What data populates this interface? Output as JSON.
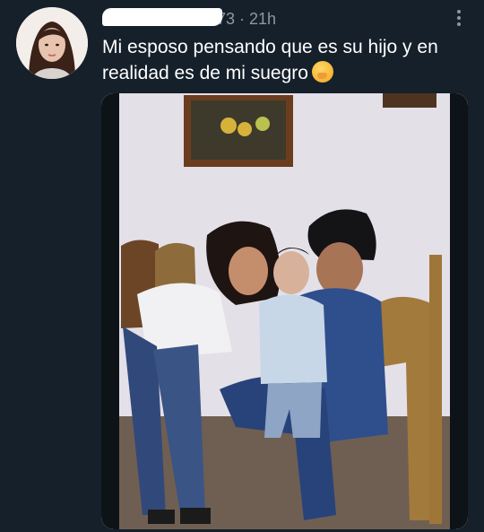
{
  "tweet": {
    "handle_visible": "73",
    "separator": "·",
    "time": "21h",
    "text": "Mi esposo pensando que es su hijo y en realidad es de mi suegro",
    "emoji": "face-with-hand-over-mouth-emoji"
  },
  "icons": {
    "more": "more-vertical-icon"
  },
  "colors": {
    "background": "#15202b",
    "secondary_text": "#8899a6",
    "primary_text": "#ffffff"
  }
}
